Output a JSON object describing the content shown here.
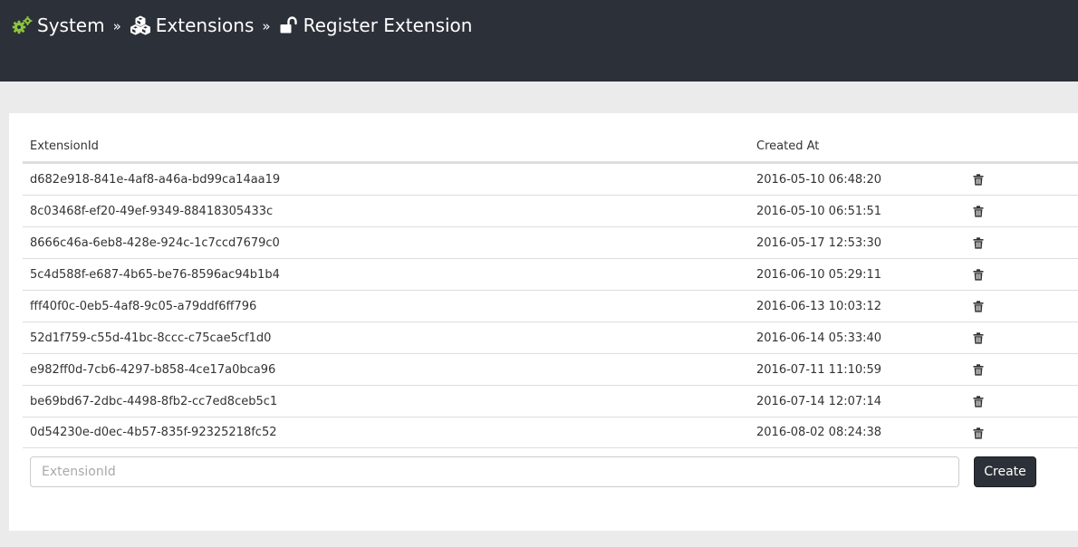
{
  "breadcrumb": {
    "items": [
      {
        "label": "System",
        "icon": "gears-icon",
        "icon_color": "#8cc63f"
      },
      {
        "label": "Extensions",
        "icon": "cubes-icon",
        "icon_color": "#ffffff"
      },
      {
        "label": "Register Extension",
        "icon": "unlock-icon",
        "icon_color": "#ffffff"
      }
    ],
    "separator": "»"
  },
  "table": {
    "headers": {
      "extension_id": "ExtensionId",
      "created_at": "Created At"
    },
    "rows": [
      {
        "id": "d682e918-841e-4af8-a46a-bd99ca14aa19",
        "created": "2016-05-10 06:48:20"
      },
      {
        "id": "8c03468f-ef20-49ef-9349-88418305433c",
        "created": "2016-05-10 06:51:51"
      },
      {
        "id": "8666c46a-6eb8-428e-924c-1c7ccd7679c0",
        "created": "2016-05-17 12:53:30"
      },
      {
        "id": "5c4d588f-e687-4b65-be76-8596ac94b1b4",
        "created": "2016-06-10 05:29:11"
      },
      {
        "id": "fff40f0c-0eb5-4af8-9c05-a79ddf6ff796",
        "created": "2016-06-13 10:03:12"
      },
      {
        "id": "52d1f759-c55d-41bc-8ccc-c75cae5cf1d0",
        "created": "2016-06-14 05:33:40"
      },
      {
        "id": "e982ff0d-7cb6-4297-b858-4ce17a0bca96",
        "created": "2016-07-11 11:10:59"
      },
      {
        "id": "be69bd67-2dbc-4498-8fb2-cc7ed8ceb5c1",
        "created": "2016-07-14 12:07:14"
      },
      {
        "id": "0d54230e-d0ec-4b57-835f-92325218fc52",
        "created": "2016-08-02 08:24:38"
      }
    ],
    "delete_icon": "trash-icon"
  },
  "form": {
    "input_placeholder": "ExtensionId",
    "input_value": "",
    "create_label": "Create"
  },
  "colors": {
    "topbar": "#2c3038",
    "accent_green": "#8cc63f",
    "page_bg": "#ebebeb"
  }
}
